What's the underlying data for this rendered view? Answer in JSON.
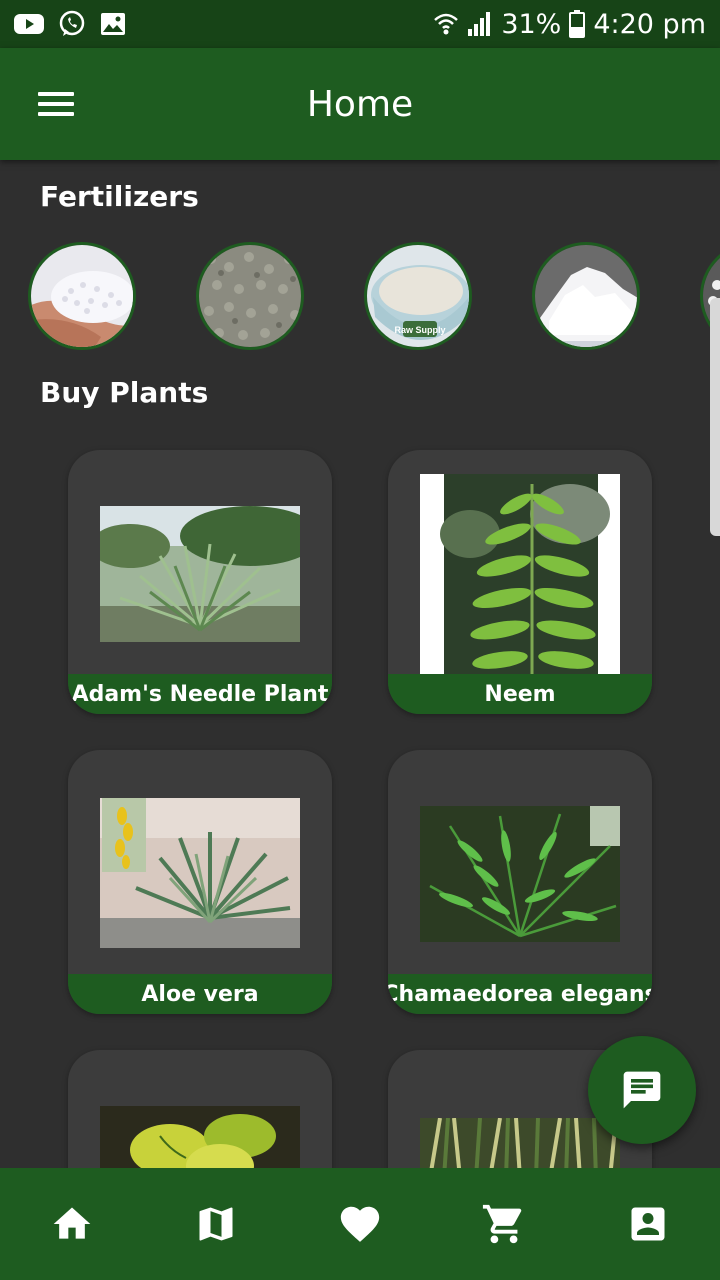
{
  "status_bar": {
    "battery": "31%",
    "time": "4:20 pm",
    "icons": [
      "youtube-icon",
      "whatsapp-icon",
      "gallery-icon",
      "wifi-icon",
      "signal-icon",
      "battery-icon"
    ]
  },
  "app_bar": {
    "title": "Home",
    "menu_icon": "hamburger-menu-icon"
  },
  "fertilizers": {
    "title": "Fertilizers",
    "items": [
      "white-granules",
      "grey-pellets",
      "white-powder-bowl",
      "white-crystals",
      "white-granules-partial"
    ],
    "bowl_text": "Raw Supply"
  },
  "plants": {
    "title": "Buy Plants",
    "items": [
      {
        "name": "Adam's Needle Plant"
      },
      {
        "name": "Neem"
      },
      {
        "name": "Aloe vera"
      },
      {
        "name": "Chamaedorea elegans"
      },
      {
        "name": ""
      },
      {
        "name": ""
      }
    ]
  },
  "fab": {
    "icon": "chat-message-icon"
  },
  "bottom_nav": {
    "items": [
      "home-icon",
      "map-icon",
      "favorite-heart-icon",
      "cart-icon",
      "account-icon"
    ]
  },
  "colors": {
    "primary": "#1e5c20",
    "status_bar": "#174417",
    "background": "#2f2f2f",
    "card": "#3c3c3c"
  }
}
